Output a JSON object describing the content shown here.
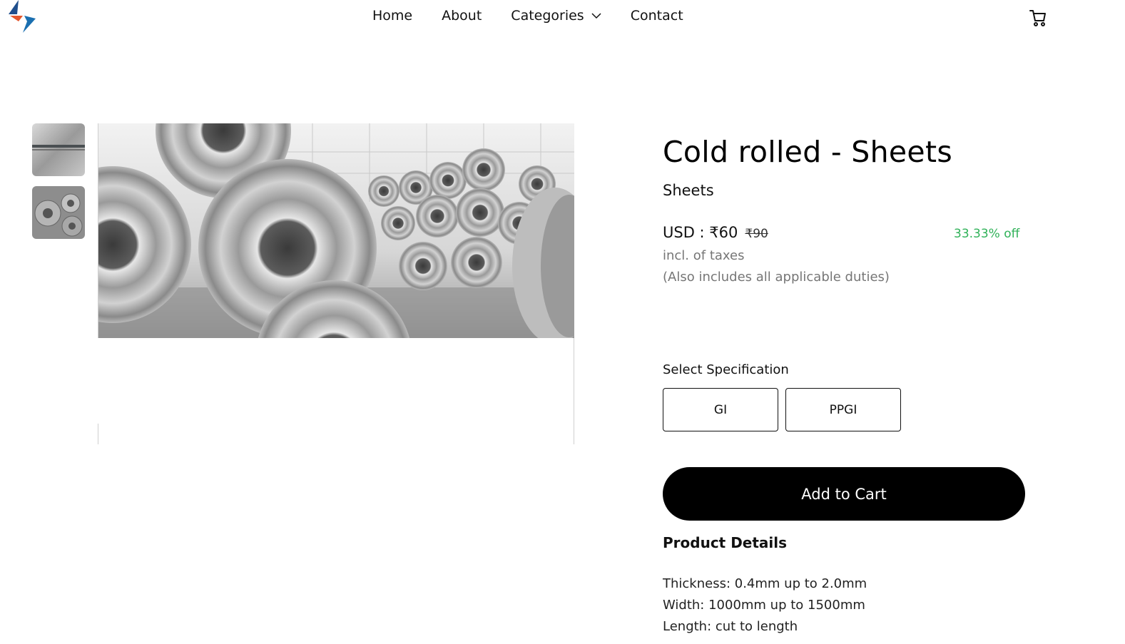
{
  "header": {
    "nav": [
      {
        "label": "Home"
      },
      {
        "label": "About"
      },
      {
        "label": "Categories",
        "has_dropdown": true
      },
      {
        "label": "Contact"
      }
    ],
    "cart_icon": "cart-icon",
    "logo_icon": "brand-logo"
  },
  "gallery": {
    "thumbnails": [
      "steel-sheet-thumbnail",
      "steel-coils-thumbnail"
    ],
    "main_image": "steel-coils-warehouse-photo"
  },
  "product": {
    "title": "Cold rolled - Sheets",
    "category": "Sheets",
    "price_prefix": "USD : ",
    "price": "₹60",
    "original_price": "₹90",
    "discount": "33.33% off",
    "tax_note": "incl. of taxes",
    "duties_note": "(Also includes all applicable duties)",
    "spec_label": "Select Specification",
    "specs": [
      "GI",
      "PPGI"
    ],
    "add_to_cart": "Add to Cart",
    "details_title": "Product Details",
    "details": [
      "Thickness: 0.4mm up to 2.0mm",
      "Width: 1000mm up to 1500mm",
      "Length: cut to length"
    ]
  },
  "colors": {
    "discount": "#2fb158",
    "button_bg": "#000000",
    "muted_text": "#767676",
    "logo_blue": "#1f4e8c",
    "logo_orange": "#e4572e"
  }
}
